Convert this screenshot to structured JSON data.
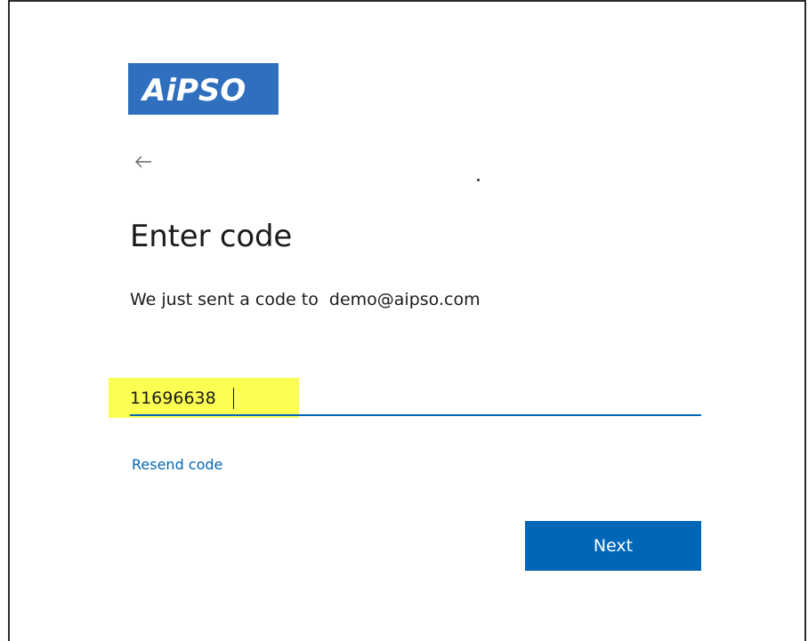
{
  "brand": {
    "logo_text": "AiPSO",
    "logo_color": "#2f6fbe"
  },
  "navigation": {
    "back_icon": "arrow-left-icon"
  },
  "page": {
    "title": "Enter code",
    "sent_prefix": "We just sent a code to",
    "email": "demo@aipso.com"
  },
  "code_field": {
    "value": "11696638",
    "highlight_color": "#fbff52",
    "underline_color": "#0067b8"
  },
  "links": {
    "resend_label": "Resend code"
  },
  "actions": {
    "next_label": "Next",
    "accent_color": "#0067b8"
  }
}
